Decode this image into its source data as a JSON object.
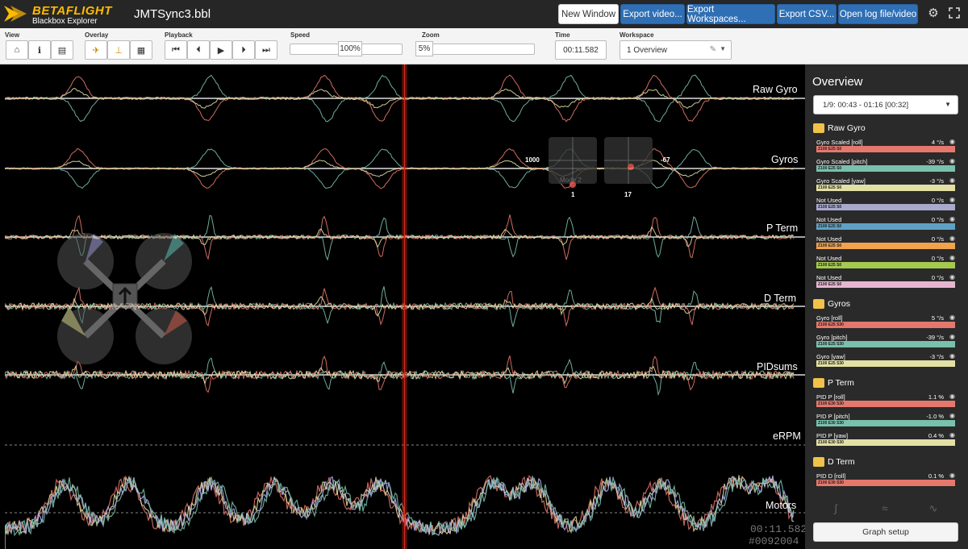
{
  "app": {
    "brand": "BETAFLIGHT",
    "brand_sub": "Blackbox Explorer",
    "filename": "JMTSync3.bbl"
  },
  "nav": {
    "new_window": "New Window",
    "export_video": "Export video...",
    "export_workspaces": "Export Workspaces...",
    "export_csv": "Export CSV...",
    "open_log": "Open log file/video"
  },
  "toolbar": {
    "view_label": "View",
    "overlay_label": "Overlay",
    "playback_label": "Playback",
    "speed_label": "Speed",
    "speed_value": "100%",
    "zoom_label": "Zoom",
    "zoom_value": "5%",
    "time_label": "Time",
    "time_value": "00:11.582",
    "workspace_label": "Workspace",
    "workspace_value": "1 Overview"
  },
  "graph": {
    "labels": [
      "Raw Gyro",
      "Gyros",
      "P Term",
      "D Term",
      "PIDsums",
      "eRPM",
      "Motors"
    ],
    "stick_left_value": "1000",
    "stick_right_value": "-67",
    "stick_left_bottom": "1",
    "stick_right_bottom": "17",
    "stick_mode": "Mode 2",
    "overlay_time": "00:11.582",
    "overlay_frame": "#0092004"
  },
  "sidebar": {
    "title": "Overview",
    "range": "1/9: 00:43 - 01:16 [00:32]",
    "groups": [
      {
        "name": "Raw Gyro",
        "fields": [
          {
            "name": "Gyro Scaled [roll]",
            "value": "4 °/s",
            "bar_text": "Z100 E25 S0",
            "color": "#e5786d"
          },
          {
            "name": "Gyro Scaled [pitch]",
            "value": "-39 °/s",
            "bar_text": "Z100 E25 S0",
            "color": "#79c0ad"
          },
          {
            "name": "Gyro Scaled [yaw]",
            "value": "-3 °/s",
            "bar_text": "Z100 E25 S0",
            "color": "#e2e0a4"
          },
          {
            "name": "Not Used",
            "value": "0 °/s",
            "bar_text": "Z100 E25 S0",
            "color": "#a8a9cb"
          },
          {
            "name": "Not Used",
            "value": "0 °/s",
            "bar_text": "Z100 E25 S0",
            "color": "#5fa1c4"
          },
          {
            "name": "Not Used",
            "value": "0 °/s",
            "bar_text": "Z100 E25 S0",
            "color": "#f0a24c"
          },
          {
            "name": "Not Used",
            "value": "0 °/s",
            "bar_text": "Z100 E25 S0",
            "color": "#a6c950"
          },
          {
            "name": "Not Used",
            "value": "0 °/s",
            "bar_text": "Z100 E25 S0",
            "color": "#e6b6cf"
          }
        ]
      },
      {
        "name": "Gyros",
        "fields": [
          {
            "name": "Gyro [roll]",
            "value": "5 °/s",
            "bar_text": "Z100 E25 S30",
            "color": "#e5786d"
          },
          {
            "name": "Gyro [pitch]",
            "value": "-39 °/s",
            "bar_text": "Z100 E25 S30",
            "color": "#79c0ad"
          },
          {
            "name": "Gyro [yaw]",
            "value": "-3 °/s",
            "bar_text": "Z100 E25 S30",
            "color": "#e2e0a4"
          }
        ]
      },
      {
        "name": "P Term",
        "fields": [
          {
            "name": "PID P [roll]",
            "value": "1.1 %",
            "bar_text": "Z100 E30 S30",
            "color": "#e5786d"
          },
          {
            "name": "PID P [pitch]",
            "value": "-1.0 %",
            "bar_text": "Z100 E30 S30",
            "color": "#79c0ad"
          },
          {
            "name": "PID P [yaw]",
            "value": "0.4 %",
            "bar_text": "Z100 E30 S30",
            "color": "#e2e0a4"
          }
        ]
      },
      {
        "name": "D Term",
        "fields": [
          {
            "name": "PID D [roll]",
            "value": "0.1 %",
            "bar_text": "Z100 E30 S30",
            "color": "#e5786d"
          }
        ]
      }
    ],
    "graph_setup": "Graph setup"
  },
  "colors": {
    "roll": "#e5786d",
    "pitch": "#79c0ad",
    "yaw": "#e2e0a4",
    "cursor": "#d02c1c",
    "brand": "#ffbb00",
    "nav_button": "#2f6fb5"
  }
}
